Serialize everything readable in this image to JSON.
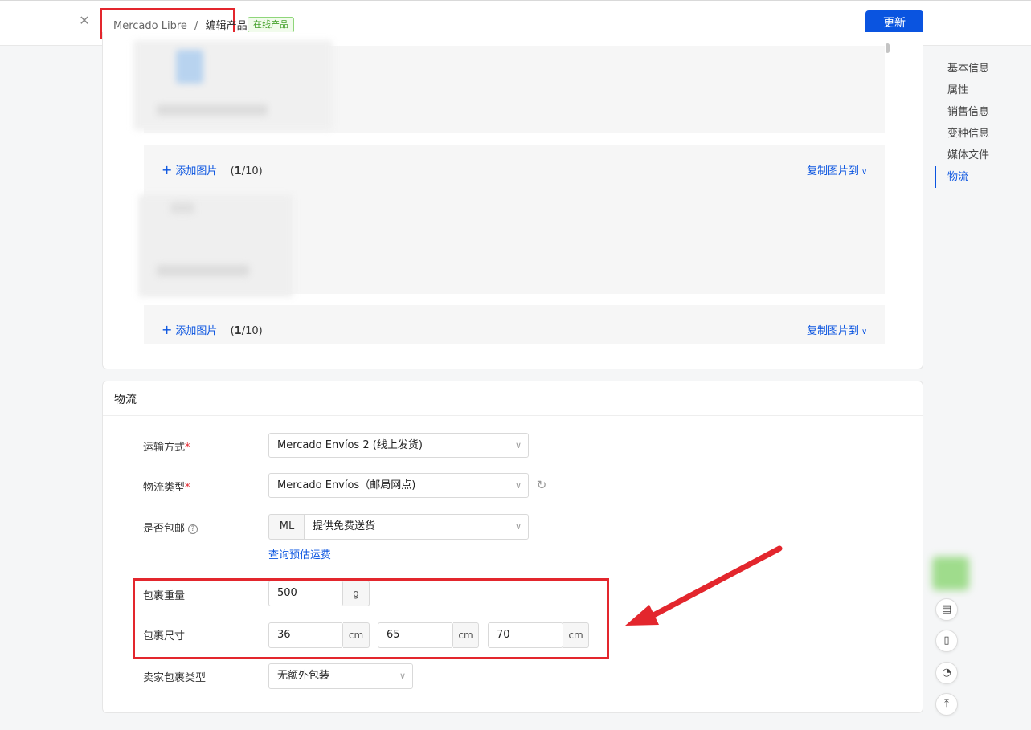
{
  "header": {
    "close_icon": "close-icon",
    "breadcrumb_root": "Mercado Libre",
    "breadcrumb_sep": "/",
    "breadcrumb_current": "编辑产品",
    "status_badge": "在线产品",
    "update_button": "更新"
  },
  "media": {
    "rows": [
      {
        "add_label": "添加图片",
        "count_current": "1",
        "count_total": "/10",
        "copy_label": "复制图片到"
      },
      {
        "add_label": "添加图片",
        "count_current": "1",
        "count_total": "/10",
        "copy_label": "复制图片到"
      }
    ]
  },
  "logistics": {
    "section_title": "物流",
    "shipping_method": {
      "label": "运输方式",
      "required": "*",
      "value": "Mercado Envíos 2 (线上发货)"
    },
    "logistics_type": {
      "label": "物流类型",
      "required": "*",
      "value": "Mercado Envíos（邮局网点)"
    },
    "free_shipping": {
      "label": "是否包邮",
      "help": "?",
      "prefix": "ML",
      "value": "提供免费送货",
      "link": "查询预估运费"
    },
    "package_weight": {
      "label": "包裹重量",
      "value": "500",
      "unit": "g"
    },
    "package_size": {
      "label": "包裹尺寸",
      "length": "36",
      "width": "65",
      "height": "70",
      "unit": "cm"
    },
    "seller_package_type": {
      "label": "卖家包裹类型",
      "value": "无额外包装"
    }
  },
  "toc": {
    "items": [
      "基本信息",
      "属性",
      "销售信息",
      "变种信息",
      "媒体文件",
      "物流"
    ],
    "active": "物流"
  },
  "float_tools": [
    "calculator-icon",
    "mobile-icon",
    "chat-icon",
    "back-to-top-icon"
  ],
  "colors": {
    "primary": "#0a54e0",
    "annotation_red": "#e3262d",
    "badge_green": "#43a02a"
  }
}
